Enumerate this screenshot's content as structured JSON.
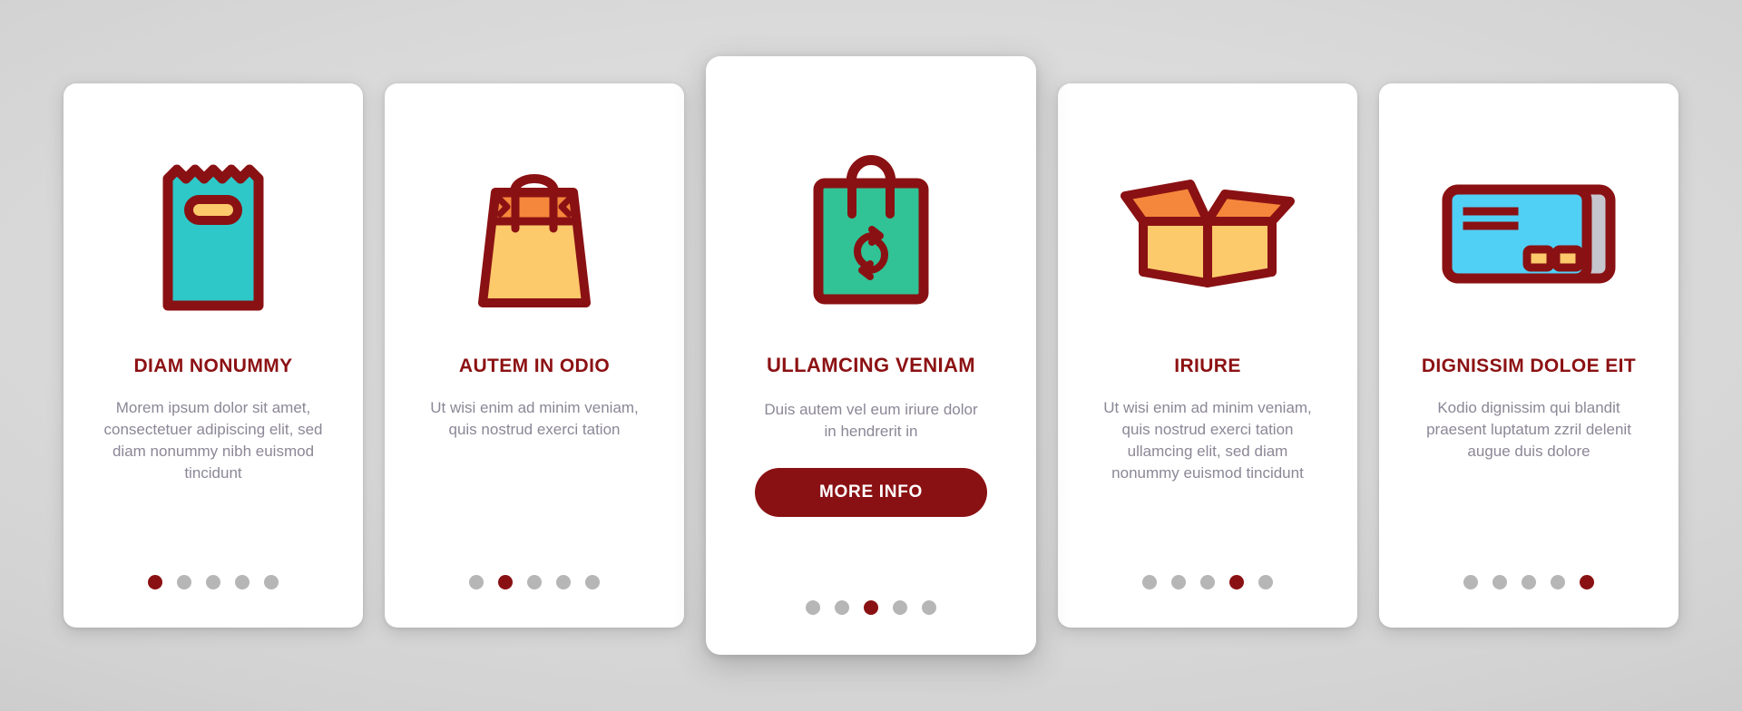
{
  "theme": {
    "accent_dark_red": "#8a1113",
    "dot_inactive": "#b6b6b6",
    "desc_text": "#8c8796",
    "card_bg": "#ffffff",
    "background": "#d4d4d4",
    "icon_teal": "#2ec8c8",
    "icon_yellow": "#fcc96b",
    "icon_orange": "#f5873c",
    "icon_green": "#31c295",
    "icon_blue": "#51d0f5",
    "icon_gray": "#c6c6ce"
  },
  "cards": [
    {
      "icon": "paper-bag-icon",
      "title": "DIAM NONUMMY",
      "description": "Morem ipsum dolor sit amet, consectetuer adipiscing elit, sed diam nonummy nibh euismod tincidunt",
      "dots": {
        "total": 5,
        "active": 1
      },
      "featured": false
    },
    {
      "icon": "shopping-bag-icon",
      "title": "AUTEM IN ODIO",
      "description": "Ut wisi enim ad minim veniam, quis nostrud exerci tation",
      "dots": {
        "total": 5,
        "active": 2
      },
      "featured": false
    },
    {
      "icon": "recycle-bag-icon",
      "title": "ULLAMCING VENIAM",
      "description": "Duis autem vel eum iriure dolor in hendrerit in",
      "button_label": "MORE INFO",
      "dots": {
        "total": 5,
        "active": 3
      },
      "featured": true
    },
    {
      "icon": "open-box-icon",
      "title": "IRIURE",
      "description": "Ut wisi enim ad minim veniam, quis nostrud exerci tation ullamcing elit, sed diam nonummy euismod tincidunt",
      "dots": {
        "total": 5,
        "active": 4
      },
      "featured": false
    },
    {
      "icon": "credit-card-icon",
      "title": "DIGNISSIM DOLOE EIT",
      "description": "Kodio dignissim qui blandit praesent luptatum zzril delenit augue duis dolore",
      "dots": {
        "total": 5,
        "active": 5
      },
      "featured": false
    }
  ]
}
